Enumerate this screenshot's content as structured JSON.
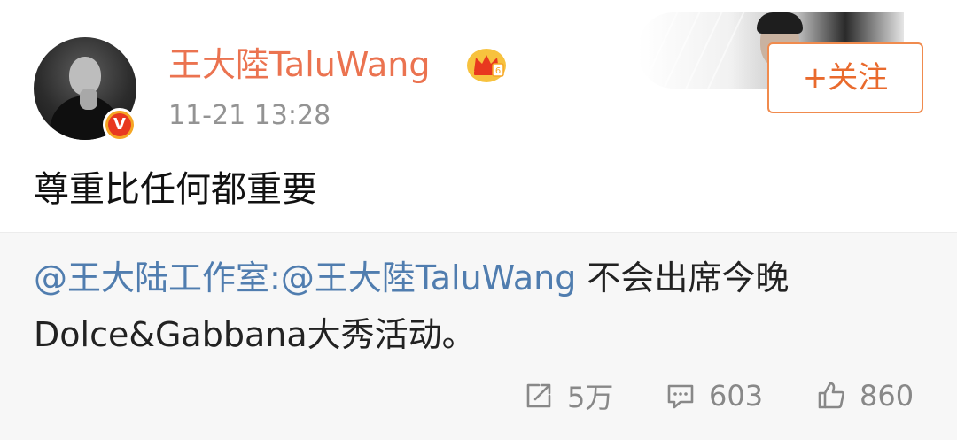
{
  "post": {
    "username": "王大陸TaluWang",
    "time": "11-21 13:28",
    "text": "尊重比任何都重要",
    "follow_label": "+关注"
  },
  "repost": {
    "mention_studio": "@王大陆工作室",
    "separator": ":",
    "mention_user": "@王大陸TaluWang",
    "text_line1_rest": " 不会出席今晚",
    "text_line2": "Dolce&Gabbana大秀活动。"
  },
  "actions": {
    "repost_count": "5万",
    "comment_count": "603",
    "like_count": "860"
  },
  "colors": {
    "username": "#eb7350",
    "mention": "#507daf",
    "follow_border": "#f08b4e",
    "badge": "#f5a623",
    "muted": "#888888"
  },
  "icons": [
    "user-avatar",
    "verified-icon",
    "crown-icon",
    "repost-icon",
    "comment-icon",
    "like-icon"
  ]
}
